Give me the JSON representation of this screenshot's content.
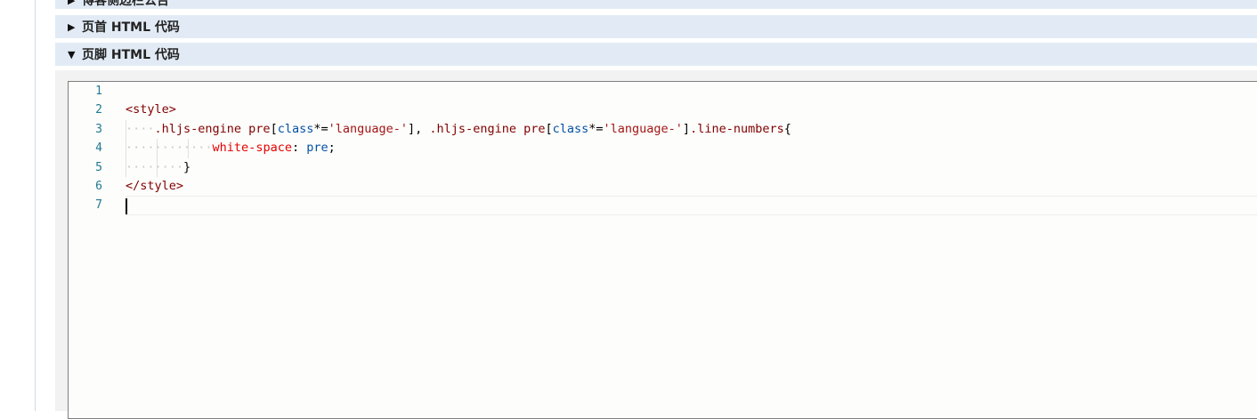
{
  "sections": [
    {
      "label": "博客侧边栏公告",
      "expanded": false
    },
    {
      "label": "页首 HTML 代码",
      "expanded": false
    },
    {
      "label": "页脚 HTML 代码",
      "expanded": true
    }
  ],
  "arrows": {
    "collapsed": "▶",
    "expanded": "▼"
  },
  "editor": {
    "line_numbers": [
      "1",
      "2",
      "3",
      "4",
      "5",
      "6",
      "7"
    ],
    "lines": {
      "l2_tag": "<style>",
      "l3_ws": "····",
      "l3_sel1": ".hljs-engine pre",
      "l3_b1": "[",
      "l3_attr1": "class",
      "l3_op1": "*=",
      "l3_str1": "'language-'",
      "l3_b2": "]",
      "l3_comma": ", ",
      "l3_sel2": ".hljs-engine pre",
      "l3_b3": "[",
      "l3_attr2": "class",
      "l3_op2": "*=",
      "l3_str2": "'language-'",
      "l3_b4": "]",
      "l3_sel3": ".line-numbers",
      "l3_brace": "{",
      "l4_ws": "············",
      "l4_prop": "white-space",
      "l4_colon": ": ",
      "l4_val": "pre",
      "l4_semi": ";",
      "l5_ws": "········",
      "l5_brace": "}",
      "l6_tag": "</style>"
    },
    "current_line": 7
  }
}
